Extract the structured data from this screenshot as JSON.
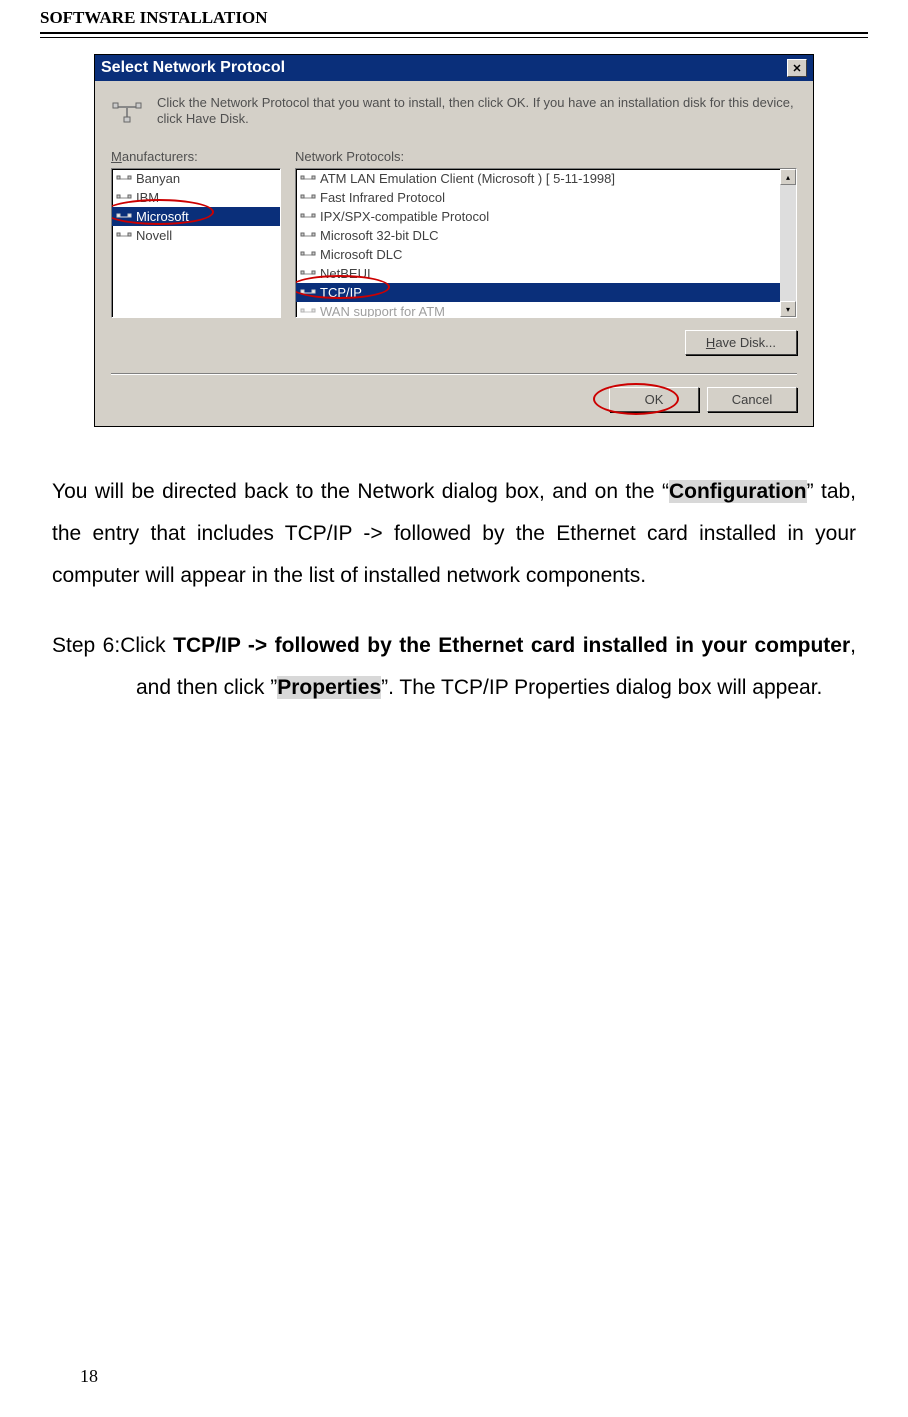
{
  "header": "SOFTWARE INSTALLATION",
  "dialog": {
    "title": "Select Network Protocol",
    "instruction": "Click the Network Protocol that you want to install, then click OK. If you have an installation disk for this device, click Have Disk.",
    "manufacturersLabel": "Manufacturers:",
    "protocolsLabel": "Network Protocols:",
    "manufacturers": [
      "Banyan",
      "IBM",
      "Microsoft",
      "Novell"
    ],
    "selectedManufacturerIndex": 2,
    "protocols": [
      "ATM LAN Emulation Client (Microsoft ) [ 5-11-1998]",
      "Fast Infrared Protocol",
      "IPX/SPX-compatible Protocol",
      "Microsoft 32-bit DLC",
      "Microsoft DLC",
      "NetBEUI",
      "TCP/IP",
      "WAN support for ATM"
    ],
    "selectedProtocolIndex": 6,
    "haveDiskBtn": "Have Disk...",
    "okBtn": "OK",
    "cancelBtn": "Cancel"
  },
  "para1_pre": "You will be directed back to the Network dialog box, and on the “",
  "para1_hl": "Configuration",
  "para1_post": "” tab, the entry that includes TCP/IP -> followed by the Ethernet card installed in your computer will appear in the list of installed network components.",
  "step6_label": "Step 6:",
  "step6_a": "Click ",
  "step6_bold1": "TCP/IP -> followed by the Ethernet card installed in your computer",
  "step6_b": ", and then click ”",
  "step6_hl": "Properties",
  "step6_c": "”. The TCP/IP Properties dialog box will appear.",
  "pageNumber": "18"
}
